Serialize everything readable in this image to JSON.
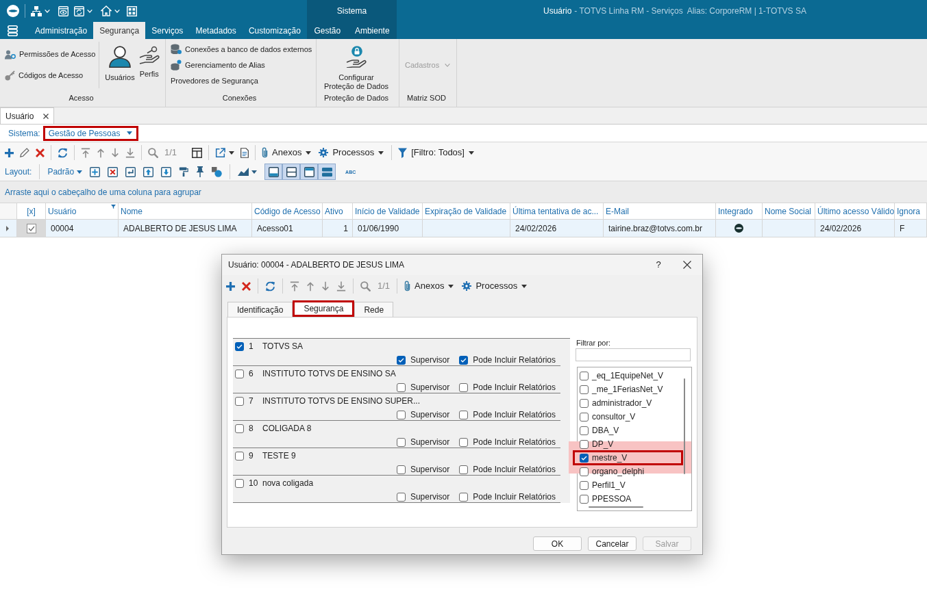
{
  "title_bar": {
    "context_title": "Sistema",
    "screen": "Usuário",
    "details": "- TOTVS Linha RM - Serviços  Alias: CorporeRM | 1-TOTVS SA"
  },
  "ribbon": {
    "tabs": [
      {
        "label": "Administração",
        "selected": false,
        "contextual": false
      },
      {
        "label": "Segurança",
        "selected": true,
        "contextual": false
      },
      {
        "label": "Serviços",
        "selected": false,
        "contextual": false
      },
      {
        "label": "Metadados",
        "selected": false,
        "contextual": false
      },
      {
        "label": "Customização",
        "selected": false,
        "contextual": false
      },
      {
        "label": "Gestão",
        "selected": false,
        "contextual": true
      },
      {
        "label": "Ambiente",
        "selected": false,
        "contextual": true
      }
    ],
    "groups": [
      {
        "title": "Acesso",
        "items": [
          {
            "kind": "small",
            "label": "Permissões de Acesso"
          },
          {
            "kind": "small",
            "label": "Códigos de Acesso"
          },
          {
            "kind": "large",
            "label": "Usuários"
          },
          {
            "kind": "large",
            "label": "Perfis"
          }
        ]
      },
      {
        "title": "Conexões",
        "items": [
          {
            "kind": "small",
            "label": "Conexões a banco de dados externos"
          },
          {
            "kind": "small",
            "label": "Gerenciamento de Alias"
          },
          {
            "kind": "small",
            "label": "Provedores de Segurança"
          }
        ]
      },
      {
        "title": "Proteção de Dados",
        "items": [
          {
            "kind": "large",
            "label": "Configurar Proteção de Dados"
          }
        ]
      },
      {
        "title": "Matriz SOD",
        "items": [
          {
            "kind": "dropdown",
            "label": "Cadastros",
            "disabled": true
          }
        ]
      }
    ]
  },
  "document_tabs": [
    {
      "label": "Usuário",
      "selected": true
    }
  ],
  "system_filter": {
    "label": "Sistema:",
    "value": "Gestão de Pessoas",
    "highlighted": true
  },
  "toolbar": {
    "counter": "1/1",
    "menus": [
      {
        "label": "Anexos"
      },
      {
        "label": "Processos"
      }
    ],
    "filter": "[Filtro: Todos]"
  },
  "layout_bar": {
    "label": "Layout:",
    "preset": "Padrão",
    "toggles": [
      {
        "on": true
      },
      {
        "on": true
      },
      {
        "on": true
      },
      {
        "on": true
      }
    ],
    "text_tool": "ABC"
  },
  "group_panel": {
    "hint": "Arraste aqui o cabeçalho de uma coluna para agrupar"
  },
  "grid": {
    "columns": [
      {
        "label": "[x]",
        "filtered": false
      },
      {
        "label": "Usuário",
        "filtered": true
      },
      {
        "label": "Nome",
        "filtered": false
      },
      {
        "label": "Código de Acesso",
        "filtered": false
      },
      {
        "label": "Ativo",
        "filtered": false
      },
      {
        "label": "Início de Validade",
        "filtered": false
      },
      {
        "label": "Expiração de Validade",
        "filtered": false
      },
      {
        "label": "Última tentativa de ac...",
        "filtered": false
      },
      {
        "label": "E-Mail",
        "filtered": false
      },
      {
        "label": "Integrado",
        "filtered": false
      },
      {
        "label": "Nome Social",
        "filtered": false
      },
      {
        "label": "Último acesso Válido",
        "filtered": false
      },
      {
        "label": "Ignora",
        "filtered": false
      }
    ],
    "rows": [
      {
        "selected": true,
        "cells": [
          {
            "kind": "check",
            "checked": true
          },
          {
            "kind": "text",
            "text": "00004"
          },
          {
            "kind": "text",
            "text": "ADALBERTO DE JESUS LIMA"
          },
          {
            "kind": "text",
            "text": "Acesso01"
          },
          {
            "kind": "number",
            "text": "1"
          },
          {
            "kind": "text",
            "text": "01/06/1990"
          },
          {
            "kind": "empty"
          },
          {
            "kind": "text",
            "text": "24/02/2026"
          },
          {
            "kind": "text",
            "text": "tairine.braz@totvs.com.br"
          },
          {
            "kind": "flag",
            "on": true
          },
          {
            "kind": "empty"
          },
          {
            "kind": "text",
            "text": "24/02/2026"
          },
          {
            "kind": "text",
            "text": "F"
          }
        ]
      }
    ]
  },
  "dialog": {
    "title": "Usuário: 00004 - ADALBERTO DE JESUS LIMA",
    "help": "?",
    "toolbar": {
      "counter": "1/1",
      "menus": [
        {
          "label": "Anexos"
        },
        {
          "label": "Processos"
        }
      ]
    },
    "tabs": [
      {
        "label": "Identificação",
        "selected": false,
        "highlighted": false
      },
      {
        "label": "Segurança",
        "selected": true,
        "highlighted": true
      },
      {
        "label": "Rede",
        "selected": false,
        "highlighted": false
      }
    ],
    "companies": [
      {
        "number": "1",
        "name": "TOTVS SA",
        "checked": true,
        "options": [
          {
            "label": "Supervisor",
            "checked": true
          },
          {
            "label": "Pode Incluir Relatórios",
            "checked": true
          }
        ]
      },
      {
        "number": "6",
        "name": "INSTITUTO TOTVS DE ENSINO SA",
        "checked": false,
        "options": [
          {
            "label": "Supervisor",
            "checked": false
          },
          {
            "label": "Pode Incluir Relatórios",
            "checked": false
          }
        ]
      },
      {
        "number": "7",
        "name": "INSTITUTO TOTVS DE ENSINO SUPER...",
        "checked": false,
        "options": [
          {
            "label": "Supervisor",
            "checked": false
          },
          {
            "label": "Pode Incluir Relatórios",
            "checked": false
          }
        ]
      },
      {
        "number": "8",
        "name": "COLIGADA 8",
        "checked": false,
        "options": [
          {
            "label": "Supervisor",
            "checked": false
          },
          {
            "label": "Pode Incluir Relatórios",
            "checked": false
          }
        ]
      },
      {
        "number": "9",
        "name": "TESTE 9",
        "checked": false,
        "options": [
          {
            "label": "Supervisor",
            "checked": false
          },
          {
            "label": "Pode Incluir Relatórios",
            "checked": false
          }
        ]
      },
      {
        "number": "10",
        "name": "nova coligada",
        "checked": false,
        "options": [
          {
            "label": "Supervisor",
            "checked": false
          },
          {
            "label": "Pode Incluir Relatórios",
            "checked": false
          }
        ]
      }
    ],
    "profile_filter": {
      "label": "Filtrar por:",
      "items": [
        {
          "label": "_eq_1EquipeNet_V",
          "checked": false,
          "highlighted": false
        },
        {
          "label": "_me_1FeriasNet_V",
          "checked": false,
          "highlighted": false
        },
        {
          "label": "administrador_V",
          "checked": false,
          "highlighted": false
        },
        {
          "label": "consultor_V",
          "checked": false,
          "highlighted": false
        },
        {
          "label": "DBA_V",
          "checked": false,
          "highlighted": false
        },
        {
          "label": "DP_V",
          "checked": false,
          "highlighted": false
        },
        {
          "label": "mestre_V",
          "checked": true,
          "highlighted": true
        },
        {
          "label": "organo_delphi",
          "checked": false,
          "highlighted": false
        },
        {
          "label": "Perfil1_V",
          "checked": false,
          "highlighted": false
        },
        {
          "label": "PPESSOA",
          "checked": false,
          "highlighted": false
        }
      ]
    },
    "buttons": [
      {
        "label": "OK",
        "disabled": false
      },
      {
        "label": "Cancelar",
        "disabled": false
      },
      {
        "label": "Salvar",
        "disabled": true
      }
    ]
  }
}
